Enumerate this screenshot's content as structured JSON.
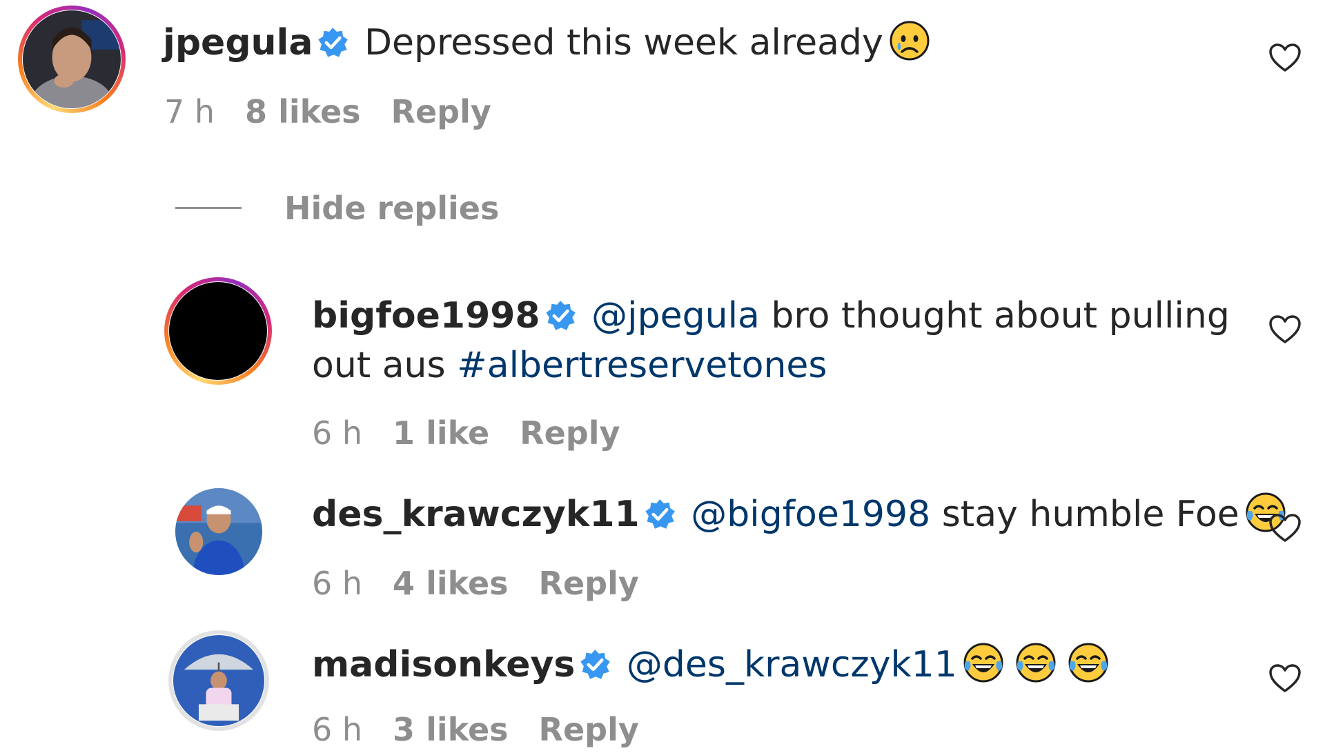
{
  "comments": [
    {
      "username": "jpegula",
      "text": "Depressed this week already",
      "emoji": "crying-face",
      "time": "7 h",
      "likes": "8 likes",
      "reply": "Reply"
    },
    {
      "username": "bigfoe1998",
      "mention": "@jpegula",
      "text_a": "bro thought about pulling",
      "text_b": "out aus",
      "hashtag": "#albertreservetones",
      "time": "6 h",
      "likes": "1 like",
      "reply": "Reply"
    },
    {
      "username": "des_krawczyk11",
      "mention": "@bigfoe1998",
      "text": "stay humble Foe",
      "emoji": "face-with-tears-of-joy",
      "time": "6 h",
      "likes": "4 likes",
      "reply": "Reply"
    },
    {
      "username": "madisonkeys",
      "mention": "@des_krawczyk11",
      "emoji": "face-with-tears-of-joy x3",
      "time": "6 h",
      "likes": "3 likes",
      "reply": "Reply"
    }
  ],
  "hide_replies_label": "Hide replies",
  "colors": {
    "verified": "#3897f0",
    "mention": "#00376b",
    "meta": "#8e8e8e",
    "text": "#262626"
  }
}
